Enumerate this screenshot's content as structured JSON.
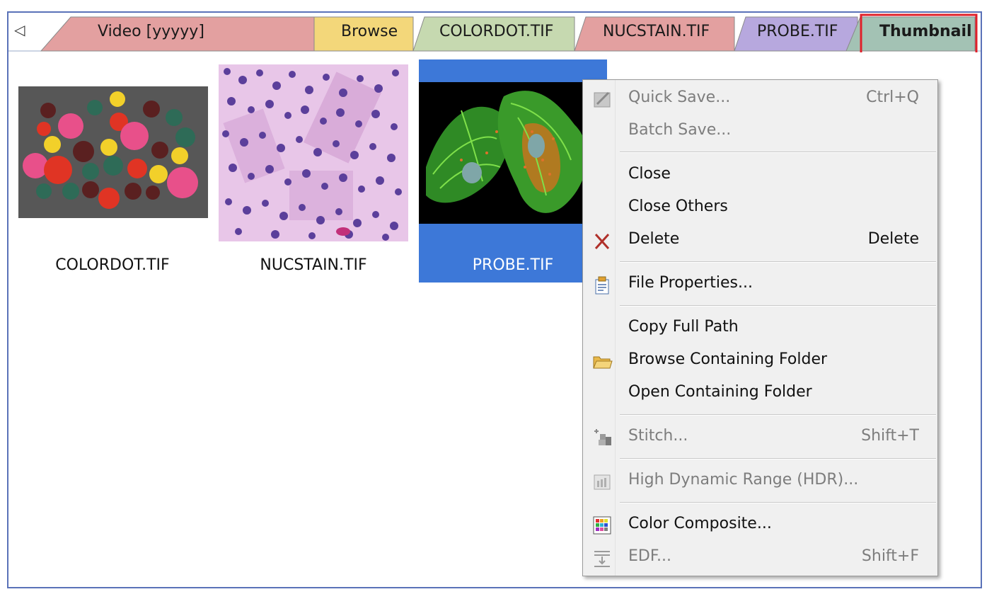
{
  "tabs": [
    {
      "label": "Video [yyyyy]",
      "color": "#e3a0a0"
    },
    {
      "label": "Browse",
      "color": "#f3d77a"
    },
    {
      "label": "COLORDOT.TIF",
      "color": "#c6d9b0"
    },
    {
      "label": "NUCSTAIN.TIF",
      "color": "#e3a0a0"
    },
    {
      "label": "PROBE.TIF",
      "color": "#b7a8de"
    },
    {
      "label": "Thumbnail",
      "color": "#a3c2b4",
      "active": true
    }
  ],
  "highlight_color": "#e0202a",
  "thumbnails": [
    {
      "name": "COLORDOT.TIF",
      "icon": "colordot-image"
    },
    {
      "name": "NUCSTAIN.TIF",
      "icon": "nucstain-image"
    },
    {
      "name": "PROBE.TIF",
      "icon": "probe-image",
      "selected": true
    }
  ],
  "menu": {
    "items": [
      {
        "id": "quick-save",
        "label": "Quick Save...",
        "shortcut": "Ctrl+Q",
        "disabled": true,
        "icon": "quick-save-icon"
      },
      {
        "id": "batch-save",
        "label": "Batch Save...",
        "shortcut": "",
        "disabled": true
      },
      {
        "id": "close",
        "label": "Close",
        "shortcut": ""
      },
      {
        "id": "close-others",
        "label": "Close Others",
        "shortcut": ""
      },
      {
        "id": "delete",
        "label": "Delete",
        "shortcut": "Delete",
        "icon": "delete-x-icon"
      },
      {
        "id": "file-properties",
        "label": "File Properties...",
        "shortcut": "",
        "icon": "file-properties-icon"
      },
      {
        "id": "copy-full-path",
        "label": "Copy Full Path",
        "shortcut": ""
      },
      {
        "id": "browse-containing-folder",
        "label": "Browse Containing Folder",
        "shortcut": "",
        "icon": "folder-icon"
      },
      {
        "id": "open-containing-folder",
        "label": "Open Containing Folder",
        "shortcut": ""
      },
      {
        "id": "stitch",
        "label": "Stitch...",
        "shortcut": "Shift+T",
        "disabled": true,
        "icon": "stitch-icon"
      },
      {
        "id": "hdr",
        "label": "High Dynamic Range (HDR)...",
        "shortcut": "",
        "disabled": true,
        "icon": "hdr-icon"
      },
      {
        "id": "color-composite",
        "label": "Color Composite...",
        "shortcut": "",
        "icon": "color-composite-icon"
      },
      {
        "id": "edf",
        "label": "EDF...",
        "shortcut": "Shift+F",
        "disabled": true,
        "icon": "edf-icon"
      }
    ]
  }
}
